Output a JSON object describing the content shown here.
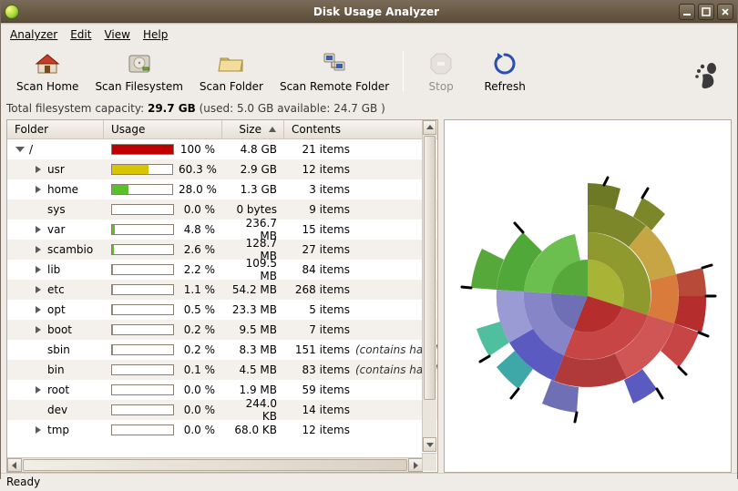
{
  "window": {
    "title": "Disk Usage Analyzer"
  },
  "menu": {
    "analyzer": "Analyzer",
    "edit": "Edit",
    "view": "View",
    "help": "Help"
  },
  "toolbar": {
    "scan_home": "Scan Home",
    "scan_filesystem": "Scan Filesystem",
    "scan_folder": "Scan Folder",
    "scan_remote": "Scan Remote Folder",
    "stop": "Stop",
    "refresh": "Refresh"
  },
  "capacity": {
    "prefix": "Total filesystem capacity: ",
    "total": "29.7 GB",
    "suffix": " (used: 5.0 GB available: 24.7 GB )"
  },
  "columns": {
    "folder": "Folder",
    "usage": "Usage",
    "size": "Size",
    "contents": "Contents"
  },
  "rows": [
    {
      "depth": 0,
      "expanded": true,
      "expandable": true,
      "name": "/",
      "pct": "100 %",
      "pctv": 100,
      "barcolor": "#c00000",
      "size": "4.8 GB",
      "contents": "21 items",
      "note": ""
    },
    {
      "depth": 1,
      "expanded": false,
      "expandable": true,
      "name": "usr",
      "pct": "60.3 %",
      "pctv": 60.3,
      "barcolor": "#d9c400",
      "size": "2.9 GB",
      "contents": "12 items",
      "note": ""
    },
    {
      "depth": 1,
      "expanded": false,
      "expandable": true,
      "name": "home",
      "pct": "28.0 %",
      "pctv": 28.0,
      "barcolor": "#57c02b",
      "size": "1.3 GB",
      "contents": "3 items",
      "note": ""
    },
    {
      "depth": 1,
      "expanded": false,
      "expandable": false,
      "name": "sys",
      "pct": "0.0 %",
      "pctv": 0.0,
      "barcolor": "#57c02b",
      "size": "0 bytes",
      "contents": "9 items",
      "note": ""
    },
    {
      "depth": 1,
      "expanded": false,
      "expandable": true,
      "name": "var",
      "pct": "4.8 %",
      "pctv": 4.8,
      "barcolor": "#57c02b",
      "size": "236.7 MB",
      "contents": "15 items",
      "note": ""
    },
    {
      "depth": 1,
      "expanded": false,
      "expandable": true,
      "name": "scambio",
      "pct": "2.6 %",
      "pctv": 2.6,
      "barcolor": "#57c02b",
      "size": "128.7 MB",
      "contents": "27 items",
      "note": ""
    },
    {
      "depth": 1,
      "expanded": false,
      "expandable": true,
      "name": "lib",
      "pct": "2.2 %",
      "pctv": 2.2,
      "barcolor": "#57c02b",
      "size": "109.5 MB",
      "contents": "84 items",
      "note": ""
    },
    {
      "depth": 1,
      "expanded": false,
      "expandable": true,
      "name": "etc",
      "pct": "1.1 %",
      "pctv": 1.1,
      "barcolor": "#57c02b",
      "size": "54.2 MB",
      "contents": "268 items",
      "note": ""
    },
    {
      "depth": 1,
      "expanded": false,
      "expandable": true,
      "name": "opt",
      "pct": "0.5 %",
      "pctv": 0.5,
      "barcolor": "#57c02b",
      "size": "23.3 MB",
      "contents": "5 items",
      "note": ""
    },
    {
      "depth": 1,
      "expanded": false,
      "expandable": true,
      "name": "boot",
      "pct": "0.2 %",
      "pctv": 0.2,
      "barcolor": "#57c02b",
      "size": "9.5 MB",
      "contents": "7 items",
      "note": ""
    },
    {
      "depth": 1,
      "expanded": false,
      "expandable": false,
      "name": "sbin",
      "pct": "0.2 %",
      "pctv": 0.2,
      "barcolor": "#57c02b",
      "size": "8.3 MB",
      "contents": "151 items",
      "note": "(contains hardl"
    },
    {
      "depth": 1,
      "expanded": false,
      "expandable": false,
      "name": "bin",
      "pct": "0.1 %",
      "pctv": 0.1,
      "barcolor": "#57c02b",
      "size": "4.5 MB",
      "contents": "83 items",
      "note": "(contains hardl"
    },
    {
      "depth": 1,
      "expanded": false,
      "expandable": true,
      "name": "root",
      "pct": "0.0 %",
      "pctv": 0.0,
      "barcolor": "#57c02b",
      "size": "1.9 MB",
      "contents": "59 items",
      "note": ""
    },
    {
      "depth": 1,
      "expanded": false,
      "expandable": false,
      "name": "dev",
      "pct": "0.0 %",
      "pctv": 0.0,
      "barcolor": "#57c02b",
      "size": "244.0 KB",
      "contents": "14 items",
      "note": ""
    },
    {
      "depth": 1,
      "expanded": false,
      "expandable": true,
      "name": "tmp",
      "pct": "0.0 %",
      "pctv": 0.0,
      "barcolor": "#57c02b",
      "size": "68.0 KB",
      "contents": "12 items",
      "note": ""
    }
  ],
  "status": "Ready"
}
